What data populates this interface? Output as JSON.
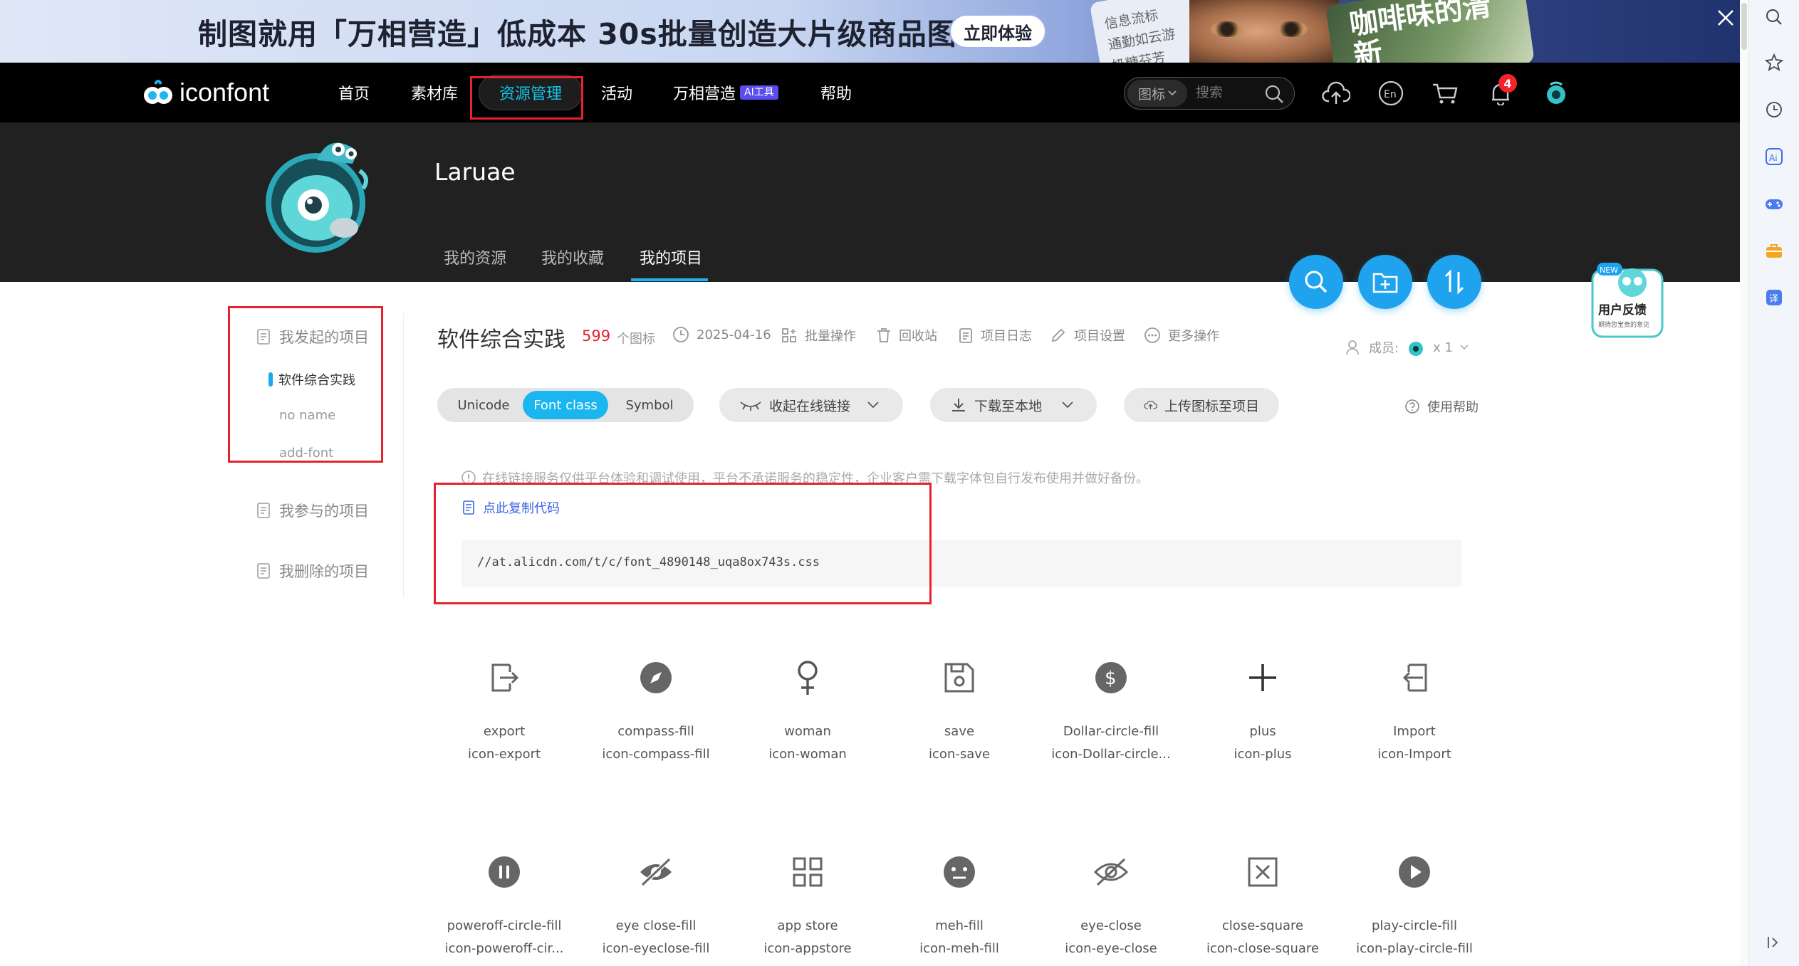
{
  "banner": {
    "headline": "制图就用「万相营造」低成本 30s批量创造大片级商品图",
    "cta": "立即体验",
    "card_lines": [
      "信息流标",
      "通勤如云游",
      "奶糖芬芳"
    ],
    "card_title": "咖啡味的清新"
  },
  "nav": {
    "logo_text": "iconfont",
    "items": [
      {
        "label": "首页"
      },
      {
        "label": "素材库"
      },
      {
        "label": "资源管理"
      },
      {
        "label": "活动"
      },
      {
        "label": "万相营造",
        "tag": "AI工具"
      },
      {
        "label": "帮助"
      }
    ],
    "search_scope": "图标",
    "search_placeholder": "搜索",
    "notification_count": "4"
  },
  "profile": {
    "username": "Laruae",
    "tabs": [
      "我的资源",
      "我的收藏",
      "我的项目"
    ]
  },
  "feedback": {
    "label": "用户反馈",
    "sub": "期待您宝贵的意见",
    "new": "NEW"
  },
  "sidebar": {
    "initiated": "我发起的项目",
    "projects": [
      "软件综合实践",
      "no name",
      "add-font"
    ],
    "joined": "我参与的项目",
    "deleted": "我删除的项目"
  },
  "project": {
    "title": "软件综合实践",
    "count": "599",
    "count_label": "个图标",
    "date": "2025-04-16",
    "tools": [
      "批量操作",
      "回收站",
      "项目日志",
      "项目设置",
      "更多操作"
    ],
    "members_label": "成员:",
    "members_count": "x 1"
  },
  "format_tabs": [
    "Unicode",
    "Font class",
    "Symbol"
  ],
  "actions": {
    "collapse_link": "收起在线链接",
    "download": "下载至本地",
    "upload": "上传图标至项目",
    "help": "使用帮助"
  },
  "notice": "在线链接服务仅供平台体验和调试使用，平台不承诺服务的稳定性，企业客户需下载字体包自行发布使用并做好备份。",
  "copy_code": "点此复制代码",
  "code_url": "//at.alicdn.com/t/c/font_4890148_uqa8ox743s.css",
  "icons": [
    {
      "name": "export",
      "cls": "icon-export",
      "glyph": "export-icon"
    },
    {
      "name": "compass-fill",
      "cls": "icon-compass-fill",
      "glyph": "compass-icon"
    },
    {
      "name": "woman",
      "cls": "icon-woman",
      "glyph": "woman-icon"
    },
    {
      "name": "save",
      "cls": "icon-save",
      "glyph": "save-icon"
    },
    {
      "name": "Dollar-circle-fill",
      "cls": "icon-Dollar-circle...",
      "glyph": "dollar-circle-icon"
    },
    {
      "name": "plus",
      "cls": "icon-plus",
      "glyph": "plus-icon"
    },
    {
      "name": "Import",
      "cls": "icon-Import",
      "glyph": "import-icon"
    },
    {
      "name": "poweroff-circle-fill",
      "cls": "icon-poweroff-cir...",
      "glyph": "pause-circle-icon"
    },
    {
      "name": "eye close-fill",
      "cls": "icon-eyeclose-fill",
      "glyph": "eye-close-icon"
    },
    {
      "name": "app store",
      "cls": "icon-appstore",
      "glyph": "appstore-icon"
    },
    {
      "name": "meh-fill",
      "cls": "icon-meh-fill",
      "glyph": "meh-icon"
    },
    {
      "name": "eye-close",
      "cls": "icon-eye-close",
      "glyph": "eye-close-outline-icon"
    },
    {
      "name": "close-square",
      "cls": "icon-close-square",
      "glyph": "close-square-icon"
    },
    {
      "name": "play-circle-fill",
      "cls": "icon-play-circle-fill",
      "glyph": "play-circle-icon"
    }
  ],
  "colors": {
    "accent": "#1fa3ef",
    "highlight": "#e4232d",
    "nav_bg": "#000000",
    "profile_bg": "#212121"
  }
}
